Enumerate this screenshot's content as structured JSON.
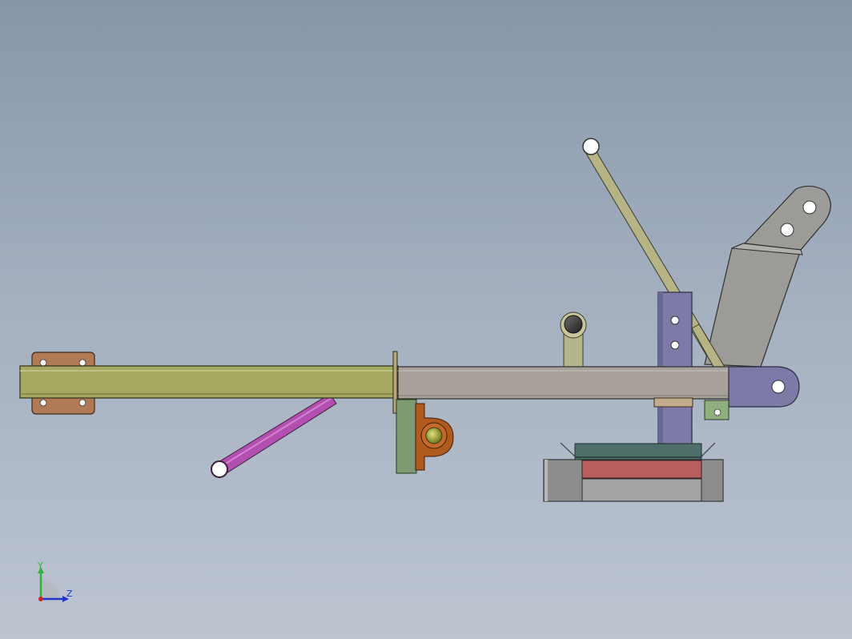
{
  "viewport": {
    "background_top": "#8796a9",
    "background_bottom": "#bcc4d0"
  },
  "parts": [
    {
      "name": "left-mounting-plate",
      "color": "#b07a55"
    },
    {
      "name": "outer-square-tube",
      "color": "#a4a860"
    },
    {
      "name": "inner-square-tube",
      "color": "#a8a19b"
    },
    {
      "name": "diagonal-brace-rod",
      "color": "#b24fb0"
    },
    {
      "name": "vertical-post",
      "color": "#7e7aa8"
    },
    {
      "name": "operating-lever",
      "color": "#b6b487"
    },
    {
      "name": "angled-bracket",
      "color": "#9c9b97"
    },
    {
      "name": "pivot-end-plate",
      "color": "#7e7aa8"
    },
    {
      "name": "bearing-block",
      "color": "#b05a1e"
    },
    {
      "name": "base-block",
      "color": "#a4a4a4"
    },
    {
      "name": "red-layer",
      "color": "#b85e5e"
    },
    {
      "name": "teal-layer",
      "color": "#4f6f6a"
    }
  ],
  "triad": {
    "y_label": "Y",
    "z_label": "Z",
    "y_color": "#2fb13a",
    "z_color": "#2434c8",
    "origin_color": "#c8242a"
  }
}
